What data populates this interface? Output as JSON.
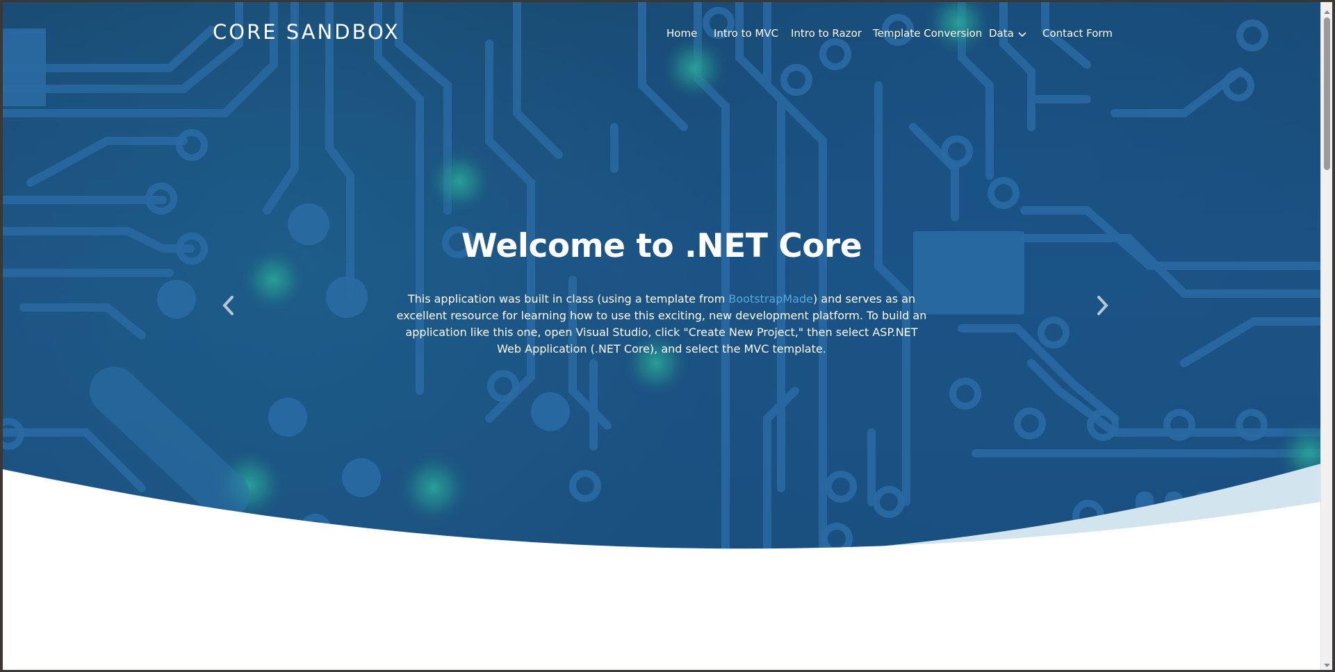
{
  "header": {
    "brand": "CORE SANDBOX",
    "nav": [
      {
        "label": "Home"
      },
      {
        "label": "Intro to MVC"
      },
      {
        "label": "Intro to Razor"
      },
      {
        "label": "Template Conversion"
      },
      {
        "label": "Data",
        "dropdown": true
      },
      {
        "label": "Contact Form"
      }
    ]
  },
  "hero": {
    "title": "Welcome to .NET Core",
    "text_before_link": "This application was built in class (using a template from ",
    "link_text": "BootstrapMade",
    "text_after_link": ") and serves as an excellent resource for learning how to use this exciting, new development platform. To build an application like this one, open Visual Studio, click \"Create New Project,\" then select ASP.NET Web Application (.NET Core), and select the MVC template.",
    "prev_icon": "chevron-left-icon",
    "next_icon": "chevron-right-icon"
  },
  "colors": {
    "hero_bg": "#1b4f7c",
    "circuit_trace": "#2a6aa3",
    "glow": "#2aa39a",
    "link": "#57a8e0",
    "wave_light": "#d2e4ee"
  }
}
